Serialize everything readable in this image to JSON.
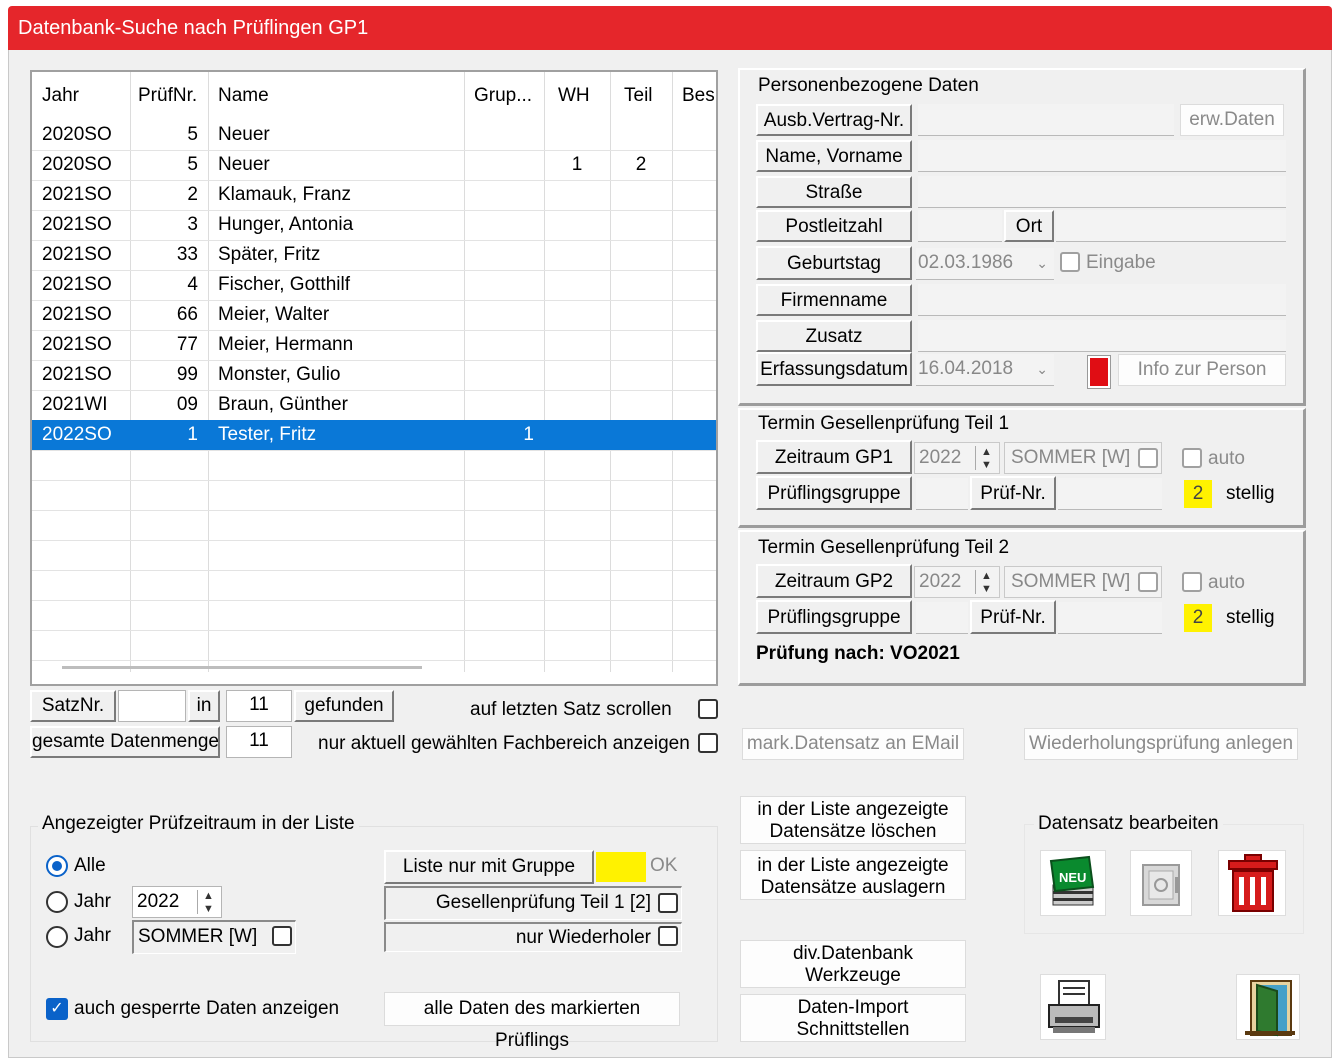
{
  "window": {
    "title": "Datenbank-Suche nach Prüflingen GP1"
  },
  "grid": {
    "columns": [
      "Jahr",
      "PrüfNr.",
      "Name",
      "Grup...",
      "WH",
      "Teil",
      "Bes"
    ],
    "rows": [
      {
        "jahr": "2020SO",
        "nr": "5",
        "name": "Neuer",
        "grup": "",
        "wh": "",
        "teil": ""
      },
      {
        "jahr": "2020SO",
        "nr": "5",
        "name": "Neuer",
        "grup": "",
        "wh": "1",
        "teil": "2"
      },
      {
        "jahr": "2021SO",
        "nr": "2",
        "name": "Klamauk, Franz",
        "grup": "",
        "wh": "",
        "teil": ""
      },
      {
        "jahr": "2021SO",
        "nr": "3",
        "name": "Hunger, Antonia",
        "grup": "",
        "wh": "",
        "teil": ""
      },
      {
        "jahr": "2021SO",
        "nr": "33",
        "name": "Später, Fritz",
        "grup": "",
        "wh": "",
        "teil": ""
      },
      {
        "jahr": "2021SO",
        "nr": "4",
        "name": "Fischer, Gotthilf",
        "grup": "",
        "wh": "",
        "teil": ""
      },
      {
        "jahr": "2021SO",
        "nr": "66",
        "name": "Meier, Walter",
        "grup": "",
        "wh": "",
        "teil": ""
      },
      {
        "jahr": "2021SO",
        "nr": "77",
        "name": "Meier, Hermann",
        "grup": "",
        "wh": "",
        "teil": ""
      },
      {
        "jahr": "2021SO",
        "nr": "99",
        "name": "Monster, Gulio",
        "grup": "",
        "wh": "",
        "teil": ""
      },
      {
        "jahr": "2021WI",
        "nr": "09",
        "name": "Braun, Günther",
        "grup": "",
        "wh": "",
        "teil": ""
      },
      {
        "jahr": "2022SO",
        "nr": "1",
        "name": "Tester, Fritz",
        "grup": "1",
        "wh": "",
        "teil": ""
      }
    ],
    "selected_index": 10
  },
  "records": {
    "satznr_label": "SatzNr.",
    "satznr_value": "",
    "in_label": "in",
    "found_count": "11",
    "gefunden_label": "gefunden",
    "scroll_last_label": "auf letzten Satz scrollen",
    "total_label": "gesamte Datenmenge",
    "total_value": "11",
    "only_current_label": "nur aktuell gewählten Fachbereich anzeigen"
  },
  "personal": {
    "title": "Personenbezogene Daten",
    "ausb_label": "Ausb.Vertrag-Nr.",
    "erw_button": "erw.Daten",
    "name_label": "Name, Vorname",
    "strasse_label": "Straße",
    "plz_label": "Postleitzahl",
    "ort_label": "Ort",
    "geburtstag_label": "Geburtstag",
    "geburtstag_value": "02.03.1986",
    "eingabe_label": "Eingabe",
    "firma_label": "Firmenname",
    "zusatz_label": "Zusatz",
    "erfassung_label": "Erfassungsdatum",
    "erfassung_value": "16.04.2018",
    "info_button": "Info zur Person"
  },
  "gp1": {
    "title": "Termin Gesellenprüfung Teil 1",
    "zeitraum_label": "Zeitraum GP1",
    "year": "2022",
    "season": "SOMMER [W]",
    "auto_label": "auto",
    "gruppe_label": "Prüflingsgruppe",
    "pruefnr_label": "Prüf-Nr.",
    "stellig_value": "2",
    "stellig_label": "stellig"
  },
  "gp2": {
    "title": "Termin Gesellenprüfung Teil 2",
    "zeitraum_label": "Zeitraum GP2",
    "year": "2022",
    "season": "SOMMER [W]",
    "auto_label": "auto",
    "gruppe_label": "Prüflingsgruppe",
    "pruefnr_label": "Prüf-Nr.",
    "stellig_value": "2",
    "stellig_label": "stellig",
    "pruefung_nach": "Prüfung nach: VO2021"
  },
  "actions": {
    "mail_button": "mark.Datensatz an EMail",
    "wiederholung_button": "Wiederholungsprüfung anlegen",
    "delete_line1": "in der Liste angezeigte",
    "delete_line2": "Datensätze löschen",
    "outsource_line1": "in der Liste angezeigte",
    "outsource_line2": "Datensätze auslagern",
    "tools_line1": "div.Datenbank",
    "tools_line2": "Werkzeuge",
    "import_line1": "Daten-Import",
    "import_line2": "Schnittstellen",
    "edit_title": "Datensatz bearbeiten",
    "new_icon_text": "NEU"
  },
  "period": {
    "title": "Angezeigter Prüfzeitraum in der Liste",
    "opt_all": "Alle",
    "opt_year": "Jahr",
    "opt_year2": "Jahr",
    "year_value": "2022",
    "season_value": "SOMMER [W]",
    "group_only": "Liste nur mit Gruppe",
    "ok_label": "OK",
    "gp_teil1": "Gesellenprüfung Teil 1  [2]",
    "only_repeaters": "nur Wiederholer",
    "show_locked": "auch gesperrte Daten anzeigen",
    "all_data_button": "alle Daten des markierten Prüflings"
  }
}
